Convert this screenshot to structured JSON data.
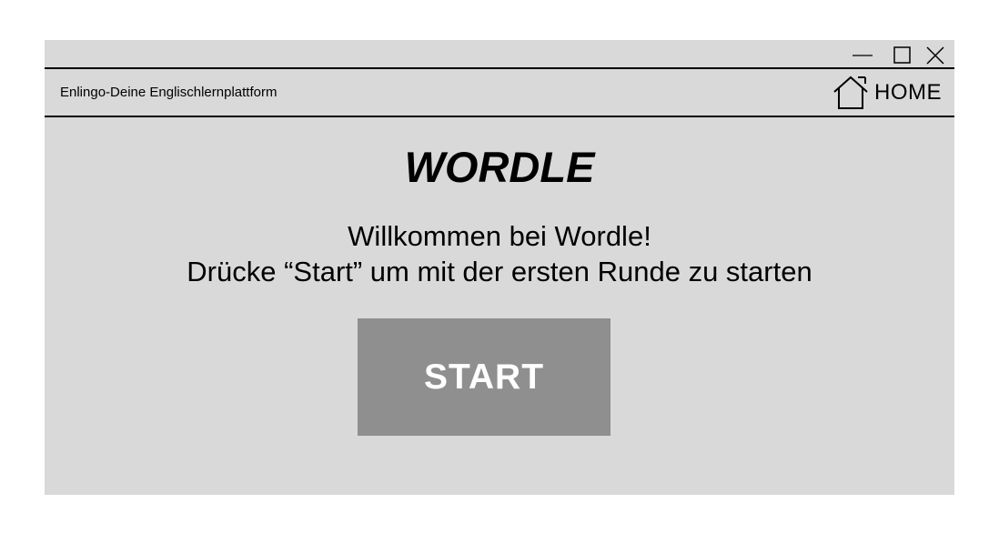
{
  "window": {
    "controls": [
      {
        "name": "minimize-icon"
      },
      {
        "name": "maximize-icon"
      },
      {
        "name": "close-icon"
      }
    ]
  },
  "navbar": {
    "app_title": "Enlingo-Deine Englischlernplattform",
    "home_icon": "house-icon",
    "home_label": "HOME"
  },
  "main": {
    "heading": "WORDLE",
    "welcome_line1": "Willkommen bei Wordle!",
    "welcome_line2": "Drücke “Start” um mit der ersten Runde zu starten",
    "start_label": "START"
  },
  "colors": {
    "window_background": "#d9d9d9",
    "button_background": "#8f8f8f",
    "button_text": "#ffffff",
    "text": "#000000"
  }
}
